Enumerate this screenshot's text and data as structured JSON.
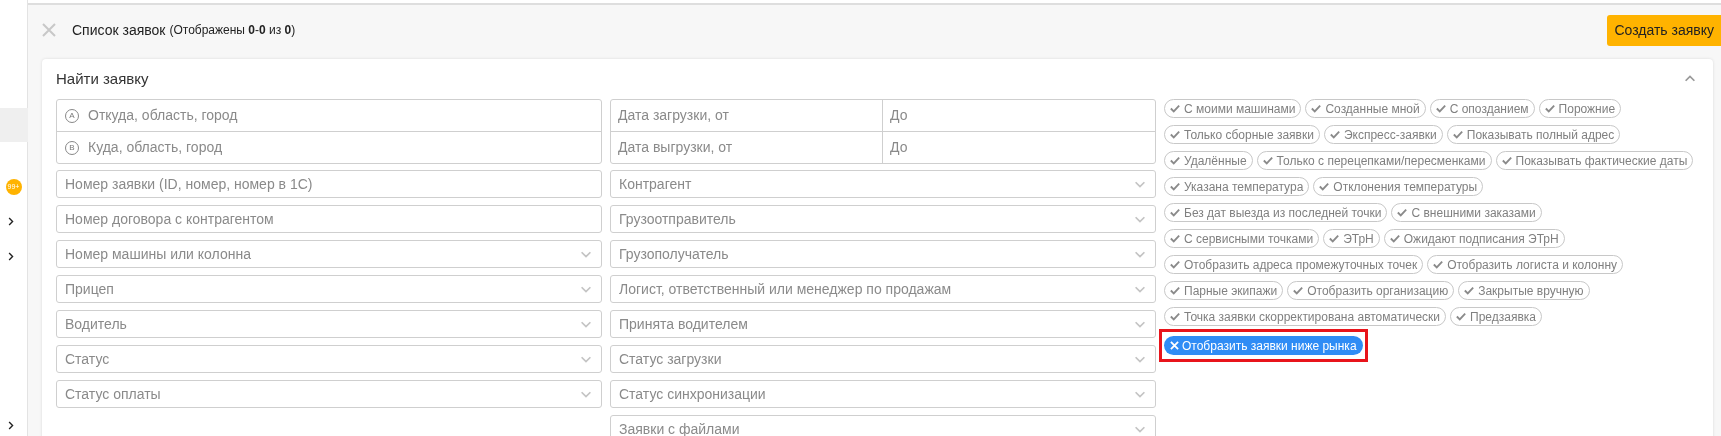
{
  "sidebar": {
    "badge": "99+"
  },
  "header": {
    "title": "Список заявок",
    "summary": "(Отображены **0**-**0** из **0**)",
    "create_button": "Создать заявку"
  },
  "search_panel": {
    "title": "Найти заявку",
    "expanded": true,
    "route": [
      {
        "marker": "A",
        "placeholder": "Откуда, область, город"
      },
      {
        "marker": "B",
        "placeholder": "Куда, область, город"
      }
    ],
    "dates": [
      {
        "from": "Дата загрузки, от",
        "to": "До"
      },
      {
        "from": "Дата выгрузки, от",
        "to": "До"
      }
    ],
    "left_fields": [
      {
        "kind": "text",
        "placeholder": "Номер заявки (ID, номер, номер в 1С)"
      },
      {
        "kind": "text",
        "placeholder": "Номер договора с контрагентом"
      },
      {
        "kind": "select",
        "placeholder": "Номер машины или колонна"
      },
      {
        "kind": "select",
        "placeholder": "Прицеп"
      },
      {
        "kind": "select",
        "placeholder": "Водитель"
      },
      {
        "kind": "select",
        "placeholder": "Статус"
      },
      {
        "kind": "select",
        "placeholder": "Статус оплаты"
      }
    ],
    "middle_fields": [
      {
        "kind": "select",
        "placeholder": "Контрагент"
      },
      {
        "kind": "select",
        "placeholder": "Грузоотправитель"
      },
      {
        "kind": "select",
        "placeholder": "Грузополучатель"
      },
      {
        "kind": "select",
        "placeholder": "Логист, ответственный или менеджер по продажам"
      },
      {
        "kind": "select",
        "placeholder": "Принята водителем"
      },
      {
        "kind": "select",
        "placeholder": "Статус загрузки"
      },
      {
        "kind": "select",
        "placeholder": "Статус синхронизации"
      },
      {
        "kind": "select",
        "placeholder": "Заявки с файлами"
      }
    ],
    "tag_rows": [
      [
        {
          "label": "С моими машинами",
          "selected": false
        },
        {
          "label": "Созданные мной",
          "selected": false
        },
        {
          "label": "С опозданием",
          "selected": false
        },
        {
          "label": "Порожние",
          "selected": false
        }
      ],
      [
        {
          "label": "Только сборные заявки",
          "selected": false
        },
        {
          "label": "Экспресс-заявки",
          "selected": false
        },
        {
          "label": "Показывать полный адрес",
          "selected": false
        }
      ],
      [
        {
          "label": "Удалённые",
          "selected": false
        },
        {
          "label": "Только с перецепками/пересменками",
          "selected": false
        },
        {
          "label": "Показывать фактические даты",
          "selected": false
        }
      ],
      [
        {
          "label": "Указана температура",
          "selected": false
        },
        {
          "label": "Отклонения температуры",
          "selected": false
        }
      ],
      [
        {
          "label": "Без дат выезда из последней точки",
          "selected": false
        },
        {
          "label": "С внешними заказами",
          "selected": false
        }
      ],
      [
        {
          "label": "С сервисными точками",
          "selected": false
        },
        {
          "label": "ЭТрН",
          "selected": false
        },
        {
          "label": "Ожидают подписания ЭТрН",
          "selected": false
        }
      ],
      [
        {
          "label": "Отобразить адреса промежуточных точек",
          "selected": false
        },
        {
          "label": "Отобразить логиста и колонну",
          "selected": false
        }
      ],
      [
        {
          "label": "Парные экипажи",
          "selected": false
        },
        {
          "label": "Отобразить организацию",
          "selected": false
        },
        {
          "label": "Закрытые вручную",
          "selected": false
        }
      ],
      [
        {
          "label": "Точка заявки скорректирована автоматически",
          "selected": false
        },
        {
          "label": "Предзаявка",
          "selected": false
        }
      ],
      [
        {
          "label": "Отобразить заявки ниже рынка",
          "selected": true,
          "highlighted": true
        }
      ]
    ]
  }
}
